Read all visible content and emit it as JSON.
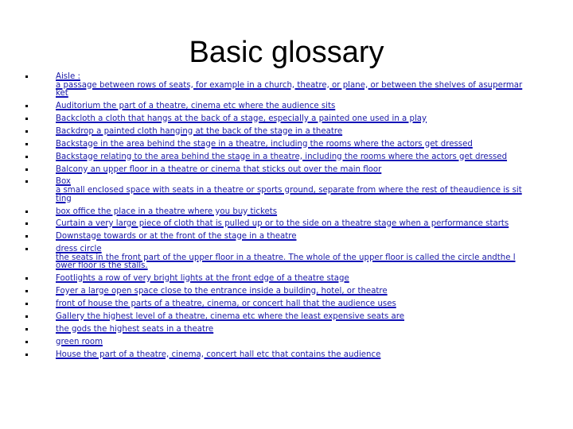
{
  "slide": {
    "title": "Basic glossary",
    "text_color": "#1a1aa6",
    "items": [
      {
        "lines": [
          "Aisle :",
          "a passage between rows of seats, for example in a church, theatre, or plane, or between the shelves of asupermar",
          "ket"
        ]
      },
      {
        "lines": [
          "Auditorium the part of a theatre, cinema etc where the audience sits"
        ]
      },
      {
        "lines": [
          "Backcloth a cloth that hangs at the back of a stage, especially a painted one used in a play"
        ]
      },
      {
        "lines": [
          "Backdrop  a painted cloth hanging at the back of the stage in a theatre"
        ]
      },
      {
        "lines": [
          "Backstage in the area behind the stage in a theatre, including the rooms where the actors get dressed"
        ]
      },
      {
        "lines": [
          "Backstage relating to the area behind the stage in a theatre, including the rooms where the actors get dressed"
        ]
      },
      {
        "lines": [
          "Balcony an upper floor in a theatre or cinema that sticks out over the main floor"
        ]
      },
      {
        "lines": [
          "Box",
          "a small enclosed space with seats in a theatre or sports ground, separate from where the rest of theaudience is sit",
          "ting"
        ]
      },
      {
        "lines": [
          "box office the place in a theatre where you buy tickets"
        ]
      },
      {
        "lines": [
          "Curtain  a very large piece of cloth that is pulled up or to the side on a theatre stage when a performance starts"
        ]
      },
      {
        "lines": [
          "Downstage  towards or at the front of the stage in a theatre"
        ]
      },
      {
        "lines": [
          "dress circle",
          "the seats in the front part of the upper floor in a theatre. The whole of the upper floor is called the circle andthe l",
          "ower floor is the stalls."
        ]
      },
      {
        "lines": [
          "Footlights  a row of very bright lights at the front edge of a theatre stage"
        ]
      },
      {
        "lines": [
          "Foyer a large open space close to the entrance inside a building, hotel, or theatre"
        ]
      },
      {
        "lines": [
          "front of house the parts of a theatre, cinema, or concert hall that the audience uses"
        ]
      },
      {
        "lines": [
          "Gallery the highest level of a theatre, cinema etc where the least expensive seats are"
        ]
      },
      {
        "lines": [
          "the gods the highest seats in a theatre"
        ]
      },
      {
        "lines": [
          "green room"
        ]
      },
      {
        "lines": [
          "House  the part of a theatre, cinema, concert hall etc that contains the audience"
        ]
      }
    ]
  }
}
